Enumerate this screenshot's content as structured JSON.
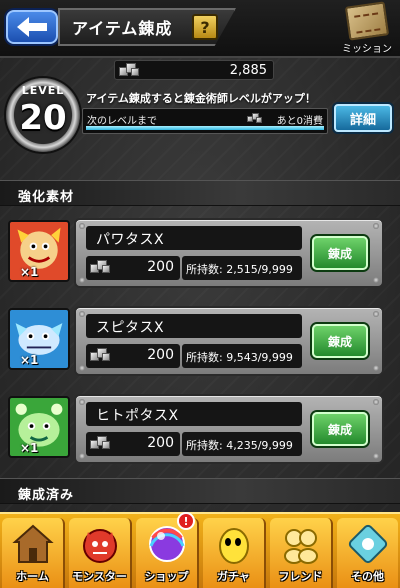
{
  "header": {
    "title": "アイテム錬成",
    "help_label": "?",
    "mission_label": "ミッション"
  },
  "resource": {
    "amount": "2,885"
  },
  "level": {
    "word": "LEVEL",
    "number": "20",
    "message": "アイテム錬成すると錬金術師レベルがアップ！",
    "next_label": "次のレベルまで",
    "remaining": "あと0消費",
    "progress_fraction": 1.0,
    "detail_label": "詳細"
  },
  "sections": {
    "materials_title": "強化素材",
    "crafted_title": "錬成済み"
  },
  "items": [
    {
      "name": "パワタスX",
      "cost": "200",
      "owned": "所持数: 2,515/9,999",
      "count": "×1",
      "craft_label": "錬成"
    },
    {
      "name": "スピタスX",
      "cost": "200",
      "owned": "所持数: 9,543/9,999",
      "count": "×1",
      "craft_label": "錬成"
    },
    {
      "name": "ヒトポタスX",
      "cost": "200",
      "owned": "所持数: 4,235/9,999",
      "count": "×1",
      "craft_label": "錬成"
    }
  ],
  "nav": [
    {
      "label": "ホーム",
      "icon": "home-icon"
    },
    {
      "label": "モンスター",
      "icon": "monster-icon"
    },
    {
      "label": "ショップ",
      "icon": "shop-orb-icon",
      "badge": "!"
    },
    {
      "label": "ガチャ",
      "icon": "gacha-egg-icon"
    },
    {
      "label": "フレンド",
      "icon": "friend-icon"
    },
    {
      "label": "その他",
      "icon": "other-icon"
    }
  ],
  "colors": {
    "header_bg": "#101010",
    "craft_button": "#2ea036",
    "detail_button": "#1f86c0",
    "nav_bg": "#f2b21a",
    "xp_fill": "#33b8e0"
  }
}
